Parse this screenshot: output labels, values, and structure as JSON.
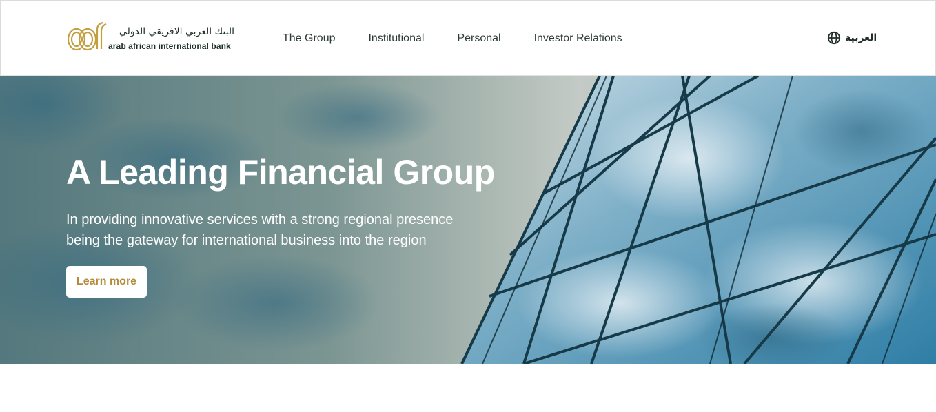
{
  "brand": {
    "name_ar": "البنك العربي الافريقي الدولي",
    "name_en": "arab african international bank",
    "gold": "#c2a042",
    "dark_green": "#1c2f25"
  },
  "nav": {
    "items": [
      {
        "label": "The Group"
      },
      {
        "label": "Institutional"
      },
      {
        "label": "Personal"
      },
      {
        "label": "Investor Relations"
      }
    ]
  },
  "language": {
    "icon": "globe-icon",
    "label": "العربية"
  },
  "hero": {
    "title": "A Leading Financial Group",
    "subtitle_line1": "In providing innovative services with a strong regional presence",
    "subtitle_line2": "being the gateway for international business into the region",
    "cta_label": "Learn more",
    "cta_color": "#b48b3a"
  }
}
